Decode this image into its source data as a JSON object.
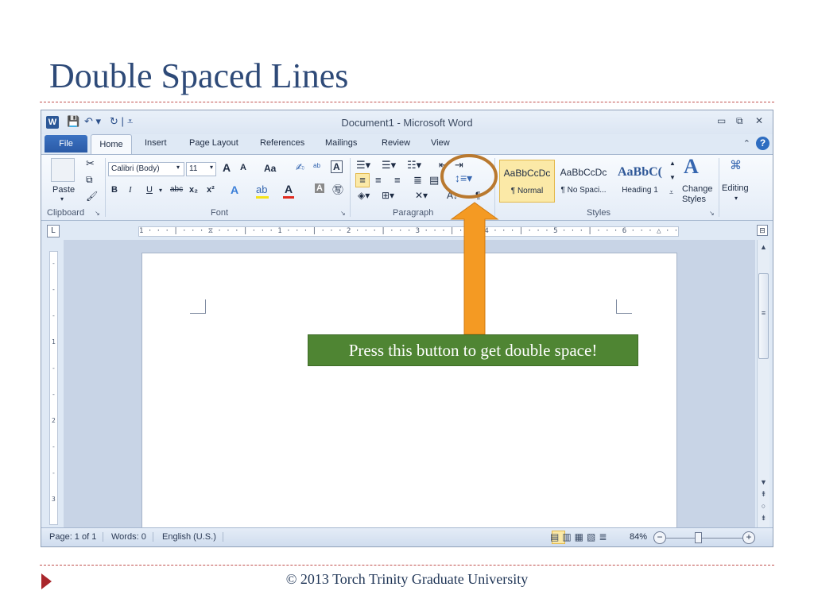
{
  "slide": {
    "title": "Double Spaced Lines",
    "footer": "© 2013 Torch Trinity Graduate University",
    "callout": "Press this button to get double space!"
  },
  "colors": {
    "title": "#2e4a78",
    "dash_line": "#c0504d",
    "callout_bg": "#4f8533",
    "arrow": "#f49a23",
    "highlight_circle": "#b9792f"
  },
  "window": {
    "title": "Document1 - Microsoft Word",
    "logo": "W"
  },
  "tabs": {
    "file": "File",
    "home": "Home",
    "insert": "Insert",
    "page_layout": "Page Layout",
    "references": "References",
    "mailings": "Mailings",
    "review": "Review",
    "view": "View"
  },
  "ribbon": {
    "clipboard": {
      "paste_label": "Paste",
      "group_label": "Clipboard"
    },
    "font": {
      "font_name": "Calibri (Body)",
      "font_size": "11",
      "grow": "A",
      "shrink": "A",
      "change_case": "Aa",
      "bold": "B",
      "italic": "I",
      "underline": "U",
      "strike": "abc",
      "subscript": "x₂",
      "superscript": "x²",
      "font_color": "A",
      "group_label": "Font"
    },
    "paragraph": {
      "group_label": "Paragraph",
      "pilcrow": "¶"
    },
    "styles": {
      "group_label": "Styles",
      "items": [
        {
          "sample": "AaBbCcDc",
          "name": "¶ Normal"
        },
        {
          "sample": "AaBbCcDc",
          "name": "¶ No Spaci..."
        },
        {
          "sample": "AaBbC(",
          "name": "Heading 1"
        }
      ],
      "change_styles_line1": "Change",
      "change_styles_line2": "Styles"
    },
    "editing": {
      "label": "Editing"
    }
  },
  "ruler": {
    "horizontal_text": "1 · · · | · · · ⧖ · · · | · · · 1 · · · | · · · 2 · · · | · · · 3 · · · | · · · 4 · · · | · · · 5 · · · | · · · 6 · · · △ · · · 7 · · ·",
    "vertical_marks": [
      "-",
      "-",
      "-",
      "1",
      "-",
      "-",
      "2",
      "-",
      "-",
      "3"
    ]
  },
  "status": {
    "page": "Page: 1 of 1",
    "words": "Words: 0",
    "language": "English (U.S.)",
    "zoom": "84%",
    "zoom_percent": 84
  }
}
